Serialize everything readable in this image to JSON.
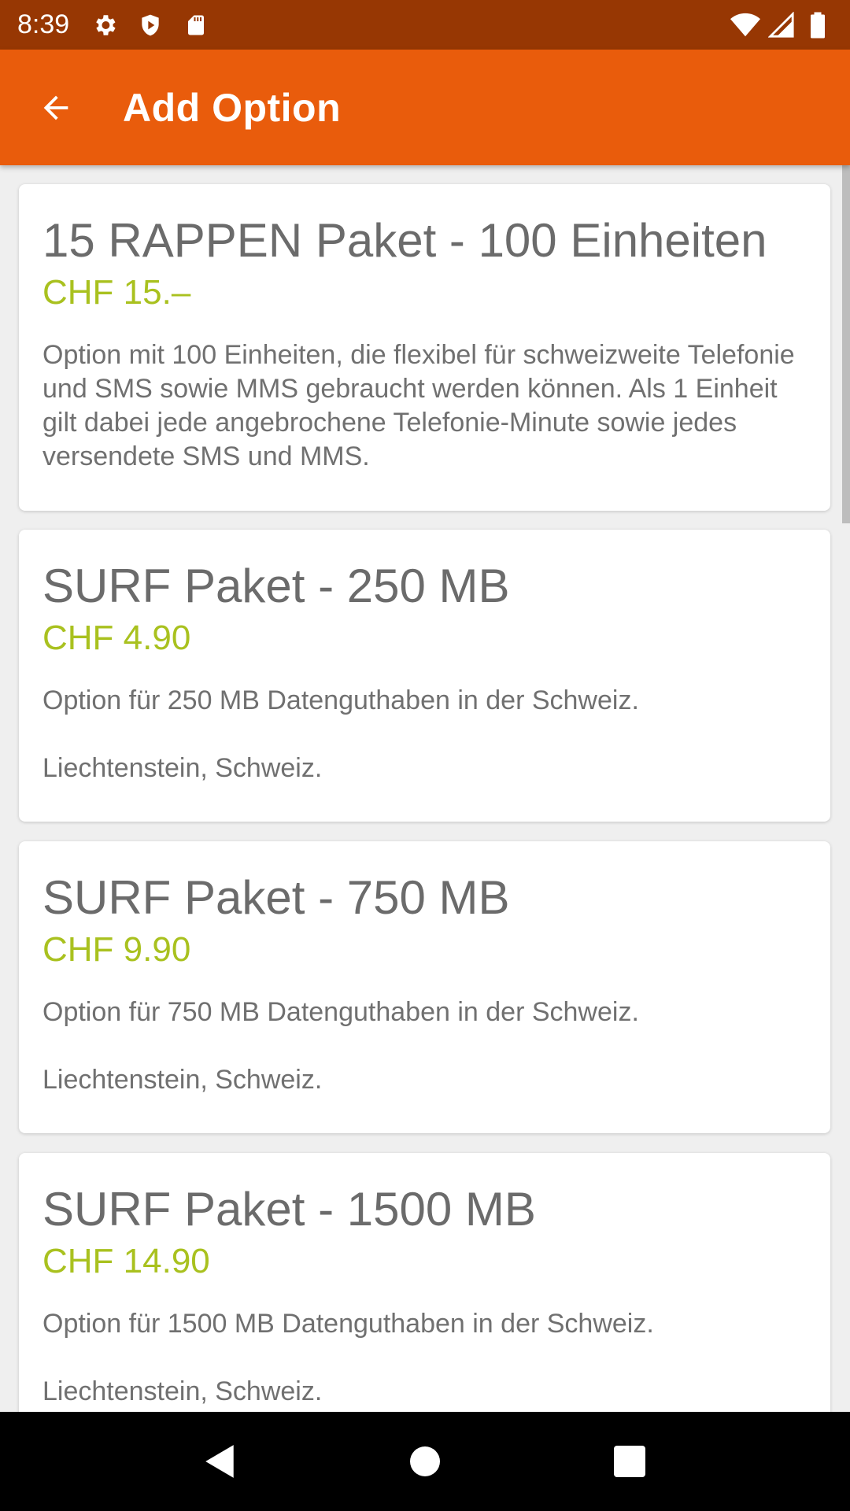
{
  "status_bar": {
    "time": "8:39",
    "left_icons": [
      "gear-icon",
      "shield-icon",
      "sd-card-icon"
    ],
    "right_icons": [
      "wifi-icon",
      "signal-icon",
      "battery-icon"
    ],
    "color": "#973703"
  },
  "app_bar": {
    "title": "Add Option",
    "back_icon": "arrow-back-icon",
    "color": "#e95c0c"
  },
  "options": [
    {
      "title": "15 RAPPEN Paket - 100 Einheiten",
      "price": "CHF 15.–",
      "description": "Option mit 100 Einheiten, die flexibel für schweizweite Telefonie und SMS sowie MMS gebraucht werden können. Als 1 Einheit gilt dabei jede angebrochene Telefonie-Minute sowie jedes versendete SMS und MMS.",
      "location": ""
    },
    {
      "title": "SURF Paket - 250 MB",
      "price": "CHF 4.90",
      "description": "Option für 250 MB Datenguthaben in der Schweiz.",
      "location": "Liechtenstein, Schweiz."
    },
    {
      "title": "SURF Paket - 750 MB",
      "price": "CHF 9.90",
      "description": "Option für 750 MB Datenguthaben in der Schweiz.",
      "location": "Liechtenstein, Schweiz."
    },
    {
      "title": "SURF Paket - 1500 MB",
      "price": "CHF 14.90",
      "description": "Option für 1500 MB Datenguthaben in der Schweiz.",
      "location": "Liechtenstein, Schweiz."
    }
  ],
  "price_color": "#a9c11f",
  "nav_bar": {
    "buttons": [
      "back-triangle-icon",
      "home-circle-icon",
      "recents-square-icon"
    ]
  }
}
